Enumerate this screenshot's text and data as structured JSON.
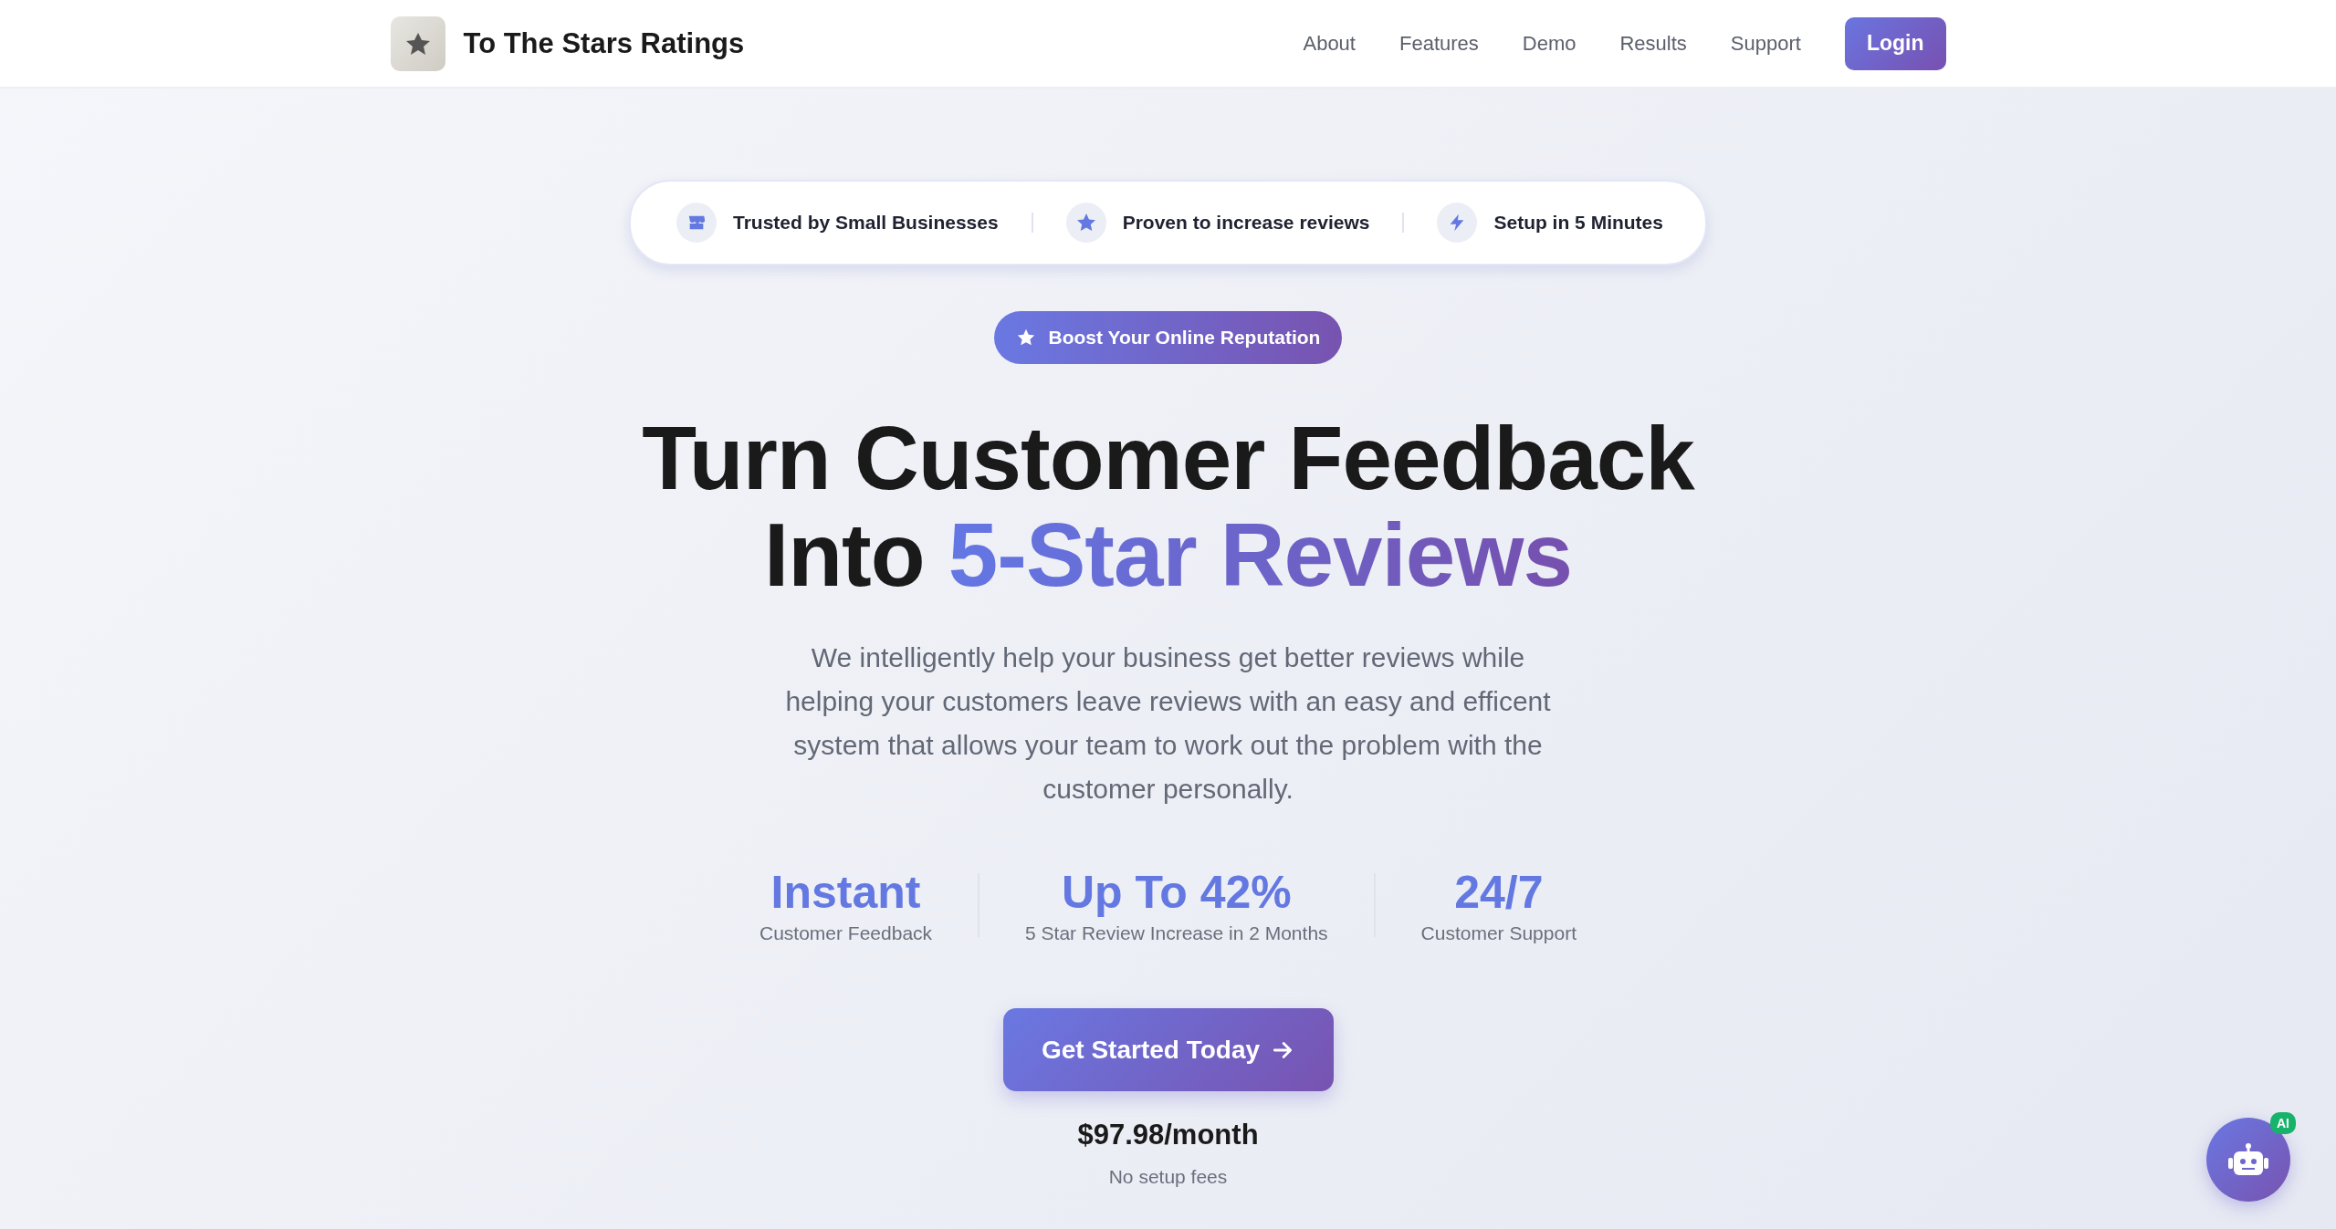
{
  "header": {
    "brand": "To The Stars Ratings",
    "nav": [
      "About",
      "Features",
      "Demo",
      "Results",
      "Support"
    ],
    "login": "Login"
  },
  "trust_badges": [
    {
      "kind": "store",
      "label": "Trusted by Small Businesses"
    },
    {
      "kind": "star",
      "label": "Proven to increase reviews"
    },
    {
      "kind": "bolt",
      "label": "Setup in 5 Minutes"
    }
  ],
  "pill": "Boost Your Online Reputation",
  "headline": {
    "line1": "Turn Customer Feedback",
    "line2_plain": "Into",
    "line2_accent": "5-Star Reviews"
  },
  "description": "We intelligently help your business get better reviews while helping your customers leave reviews with an easy and efficent system that allows your team to work out the problem with the customer personally.",
  "stats": [
    {
      "value": "Instant",
      "label": "Customer Feedback"
    },
    {
      "value": "Up To 42%",
      "label": "5 Star Review Increase in 2 Months"
    },
    {
      "value": "24/7",
      "label": "Customer Support"
    }
  ],
  "cta": {
    "button": "Get Started Today",
    "price": "$97.98/month",
    "note": "No setup fees"
  },
  "chat": {
    "badge": "AI"
  }
}
